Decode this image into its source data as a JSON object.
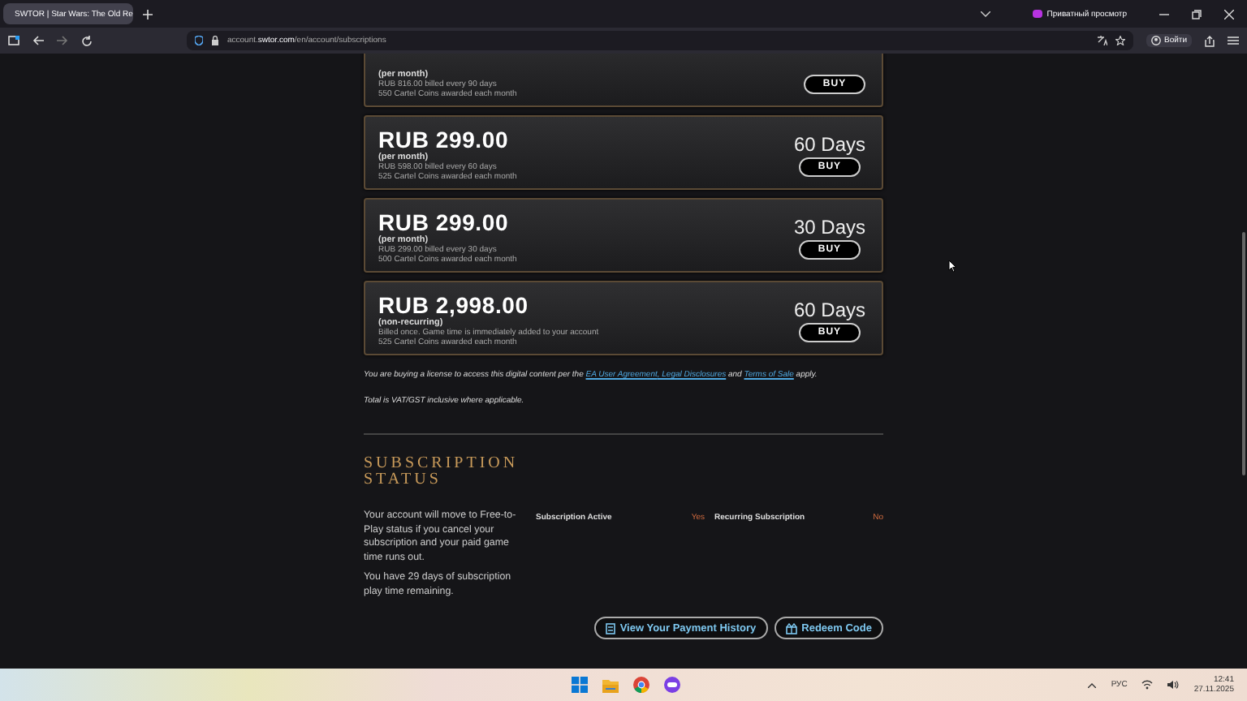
{
  "browser": {
    "tab_title": "SWTOR | Star Wars: The Old Re",
    "address": {
      "host_prefix": "account.",
      "host": "swtor.com",
      "path": "/en/account/subscriptions"
    },
    "private_label": "Приватный просмотр",
    "sign_in": "Войти"
  },
  "plans": [
    {
      "term": "(per month)",
      "billing": "RUB 816.00 billed every 90 days",
      "coins": "550 Cartel Coins awarded each month",
      "button": "BUY"
    },
    {
      "price": "RUB 299.00",
      "term": "(per month)",
      "billing": "RUB 598.00 billed every 60 days",
      "coins": "525 Cartel Coins awarded each month",
      "duration": "60 Days",
      "button": "BUY"
    },
    {
      "price": "RUB 299.00",
      "term": "(per month)",
      "billing": "RUB 299.00 billed every 30 days",
      "coins": "500 Cartel Coins awarded each month",
      "duration": "30 Days",
      "button": "BUY"
    },
    {
      "price": "RUB 2,998.00",
      "term": "(non-recurring)",
      "billing": "Billed once. Game time is immediately added to your account",
      "coins": "525 Cartel Coins awarded each month",
      "duration": "60 Days",
      "button": "BUY"
    }
  ],
  "legal": {
    "before": "You are buying a license to access this digital content per the",
    "links": [
      "EA User Agreement",
      ", Legal Disclosures"
    ],
    "and": "and",
    "last_link": "Terms of Sale",
    "after": "apply."
  },
  "vat_note": "Total is VAT/GST inclusive where applicable.",
  "subscription_status": {
    "heading": "SUBSCRIPTION STATUS",
    "paragraphs": [
      "Your account will move to Free-to-Play status if you cancel your subscription and your paid game time runs out.",
      "You have 29 days of subscription play time remaining."
    ],
    "fields": [
      {
        "label": "Subscription Active",
        "value": "Yes"
      },
      {
        "label": "Recurring Subscription",
        "value": "No"
      }
    ],
    "buttons": [
      {
        "kind": "history",
        "label": "View Your Payment History"
      },
      {
        "kind": "redeem",
        "label": "Redeem Code"
      }
    ]
  },
  "taskbar": {
    "language": "РУС",
    "time": "12:41",
    "date": "27.11.2025"
  }
}
